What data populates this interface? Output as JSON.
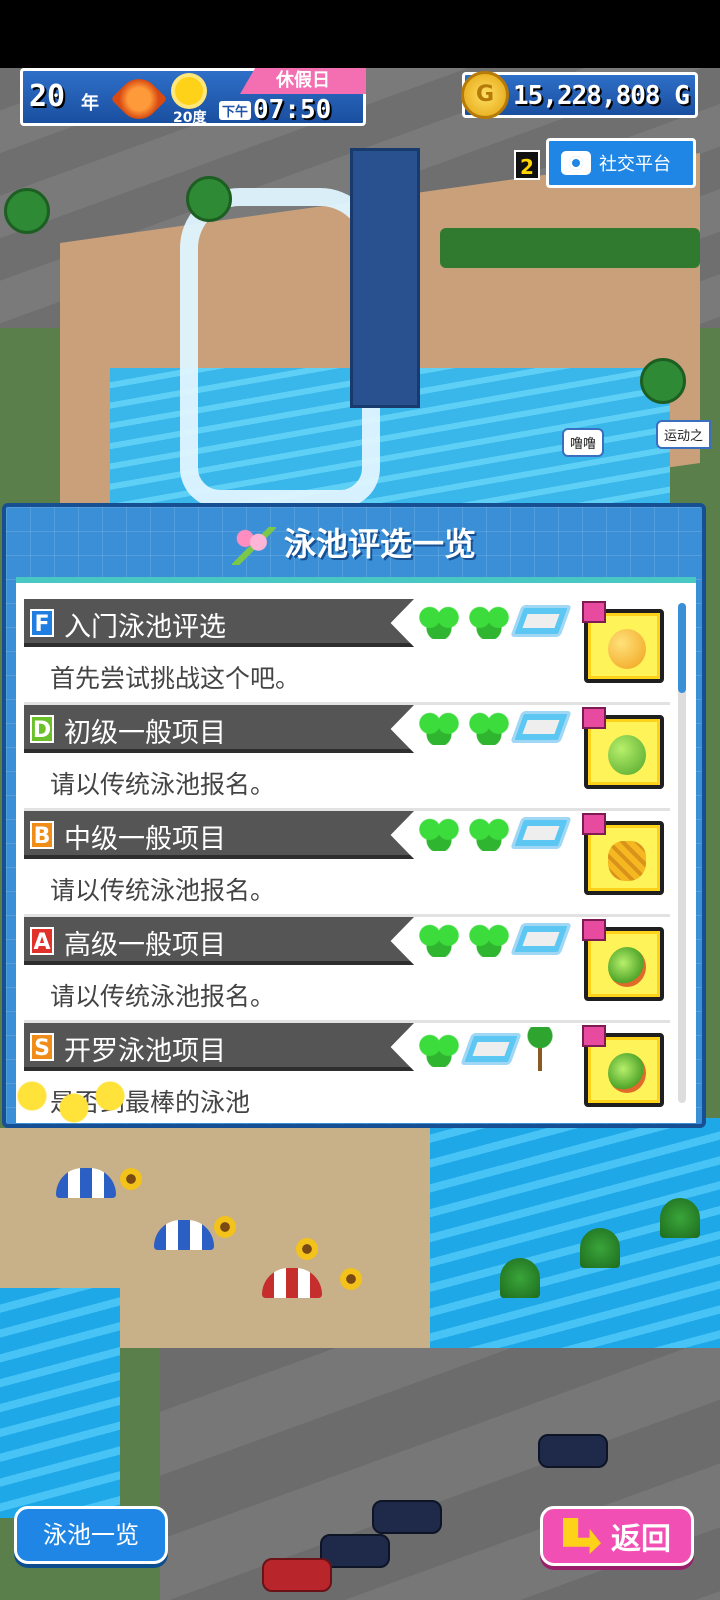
{
  "hud": {
    "year_value": "20",
    "year_unit": "年",
    "season_icon": "maple-leaf-icon",
    "weather_icon": "sun-icon",
    "temperature": "20度",
    "period": "下午",
    "time": "07:50",
    "day_type": "休假日",
    "money": "15,228,808",
    "currency_symbol": "G",
    "coin_letter": "G"
  },
  "social": {
    "count": "2",
    "label": "社交平台"
  },
  "bubbles": {
    "npc_speech": "噜噜",
    "sign_partial": "运动之"
  },
  "panel": {
    "title": "泳池评选一览",
    "items": [
      {
        "rank": "F",
        "title": "入门泳池评选",
        "desc": "首先尝试挑战这个吧。",
        "requirements": [
          "clover",
          "clover",
          "pool"
        ],
        "reward": "orange"
      },
      {
        "rank": "D",
        "title": "初级一般项目",
        "desc": "请以传统泳池报名。",
        "requirements": [
          "clover",
          "clover",
          "pool"
        ],
        "reward": "apple"
      },
      {
        "rank": "B",
        "title": "中级一般项目",
        "desc": "请以传统泳池报名。",
        "requirements": [
          "clover",
          "clover",
          "pool"
        ],
        "reward": "pineapple"
      },
      {
        "rank": "A",
        "title": "高级一般项目",
        "desc": "请以传统泳池报名。",
        "requirements": [
          "clover",
          "clover",
          "pool"
        ],
        "reward": "melon"
      },
      {
        "rank": "S",
        "title": "开罗泳池项目",
        "desc": "是否到最棒的泳池",
        "requirements": [
          "clover",
          "pool",
          "palm"
        ],
        "reward": "melon"
      }
    ]
  },
  "buttons": {
    "pool_list": "泳池一览",
    "back": "返回"
  },
  "colors": {
    "panel_blue": "#3a8fd6",
    "back_pink": "#f24fb4",
    "accent_teal": "#49c7c2"
  }
}
